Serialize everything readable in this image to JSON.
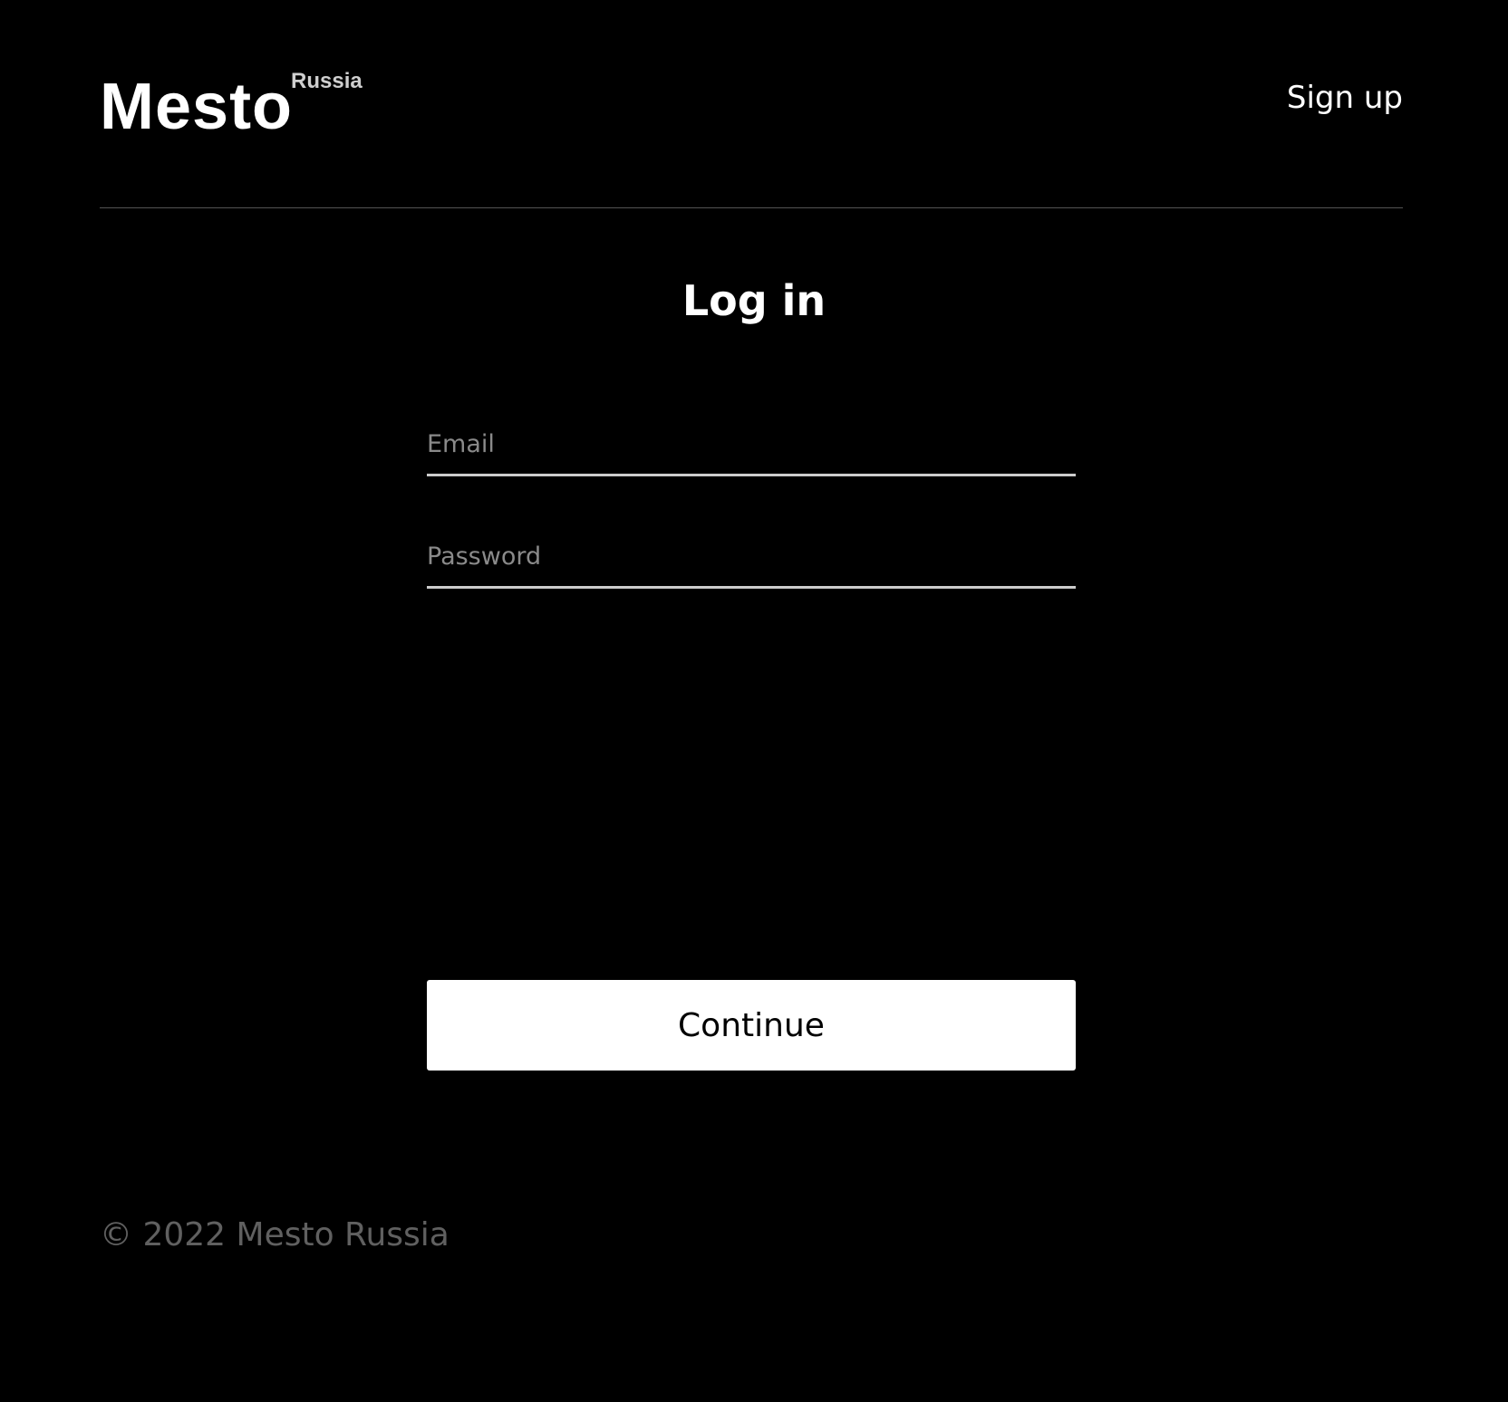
{
  "header": {
    "logo_text": "Mesto",
    "logo_superscript": "Russia",
    "signup_label": "Sign up"
  },
  "main": {
    "title": "Log in",
    "email_placeholder": "Email",
    "email_value": "",
    "password_placeholder": "Password",
    "password_value": "",
    "continue_label": "Continue"
  },
  "footer": {
    "copyright": "© 2022 Mesto Russia"
  },
  "colors": {
    "background": "#000000",
    "text": "#ffffff",
    "placeholder": "#8a8a8a",
    "divider": "#545454",
    "field_underline": "#cccccc",
    "footer_text": "#606060",
    "button_bg": "#ffffff",
    "button_text": "#000000"
  }
}
